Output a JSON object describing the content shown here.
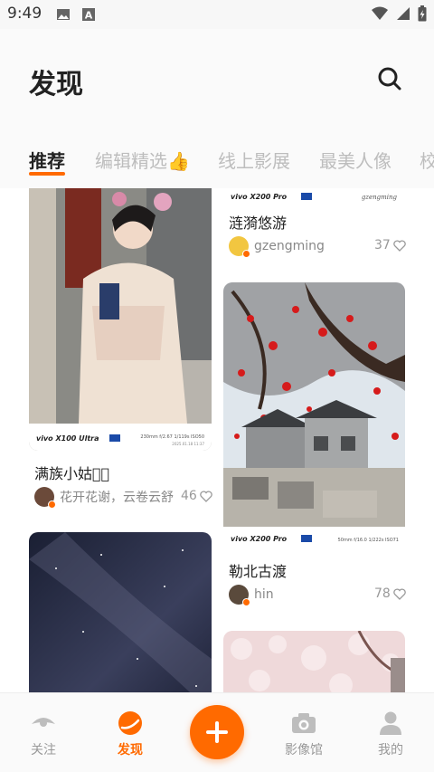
{
  "status_bar": {
    "time": "9:49"
  },
  "header": {
    "title": "发现"
  },
  "tabs": [
    {
      "label": "推荐"
    },
    {
      "label": "编辑精选👍"
    },
    {
      "label": "线上影展"
    },
    {
      "label": "最美人像"
    },
    {
      "label": "校"
    }
  ],
  "feed": {
    "left": [
      {
        "caption": "满族小姑娘🏻",
        "user": "花开花谢，云卷云舒",
        "likes": "46",
        "photo_brand": "vivo X100 Ultra",
        "photo_spec": "230mm f/2.67 1/119s ISO50",
        "photo_date": "2025.01.18 11:37"
      },
      {
        "caption": "",
        "user": "",
        "likes": ""
      }
    ],
    "right": [
      {
        "caption": "涟漪悠游",
        "user": "gzengming",
        "likes": "37",
        "photo_brand": "vivo X200 Pro",
        "photo_sign": "gzengming"
      },
      {
        "caption": "勒北古渡",
        "user": "hin",
        "likes": "78",
        "photo_brand": "vivo X200 Pro",
        "photo_spec": "50mm f/16.0 1/222s ISO71"
      }
    ]
  },
  "bottom_nav": [
    {
      "label": "关注",
      "icon": "eye-icon"
    },
    {
      "label": "发现",
      "icon": "discover-icon"
    },
    {
      "label": "",
      "icon": "plus-icon"
    },
    {
      "label": "影像馆",
      "icon": "camera-icon"
    },
    {
      "label": "我的",
      "icon": "user-icon"
    }
  ],
  "colors": {
    "accent": "#ff6a00"
  }
}
